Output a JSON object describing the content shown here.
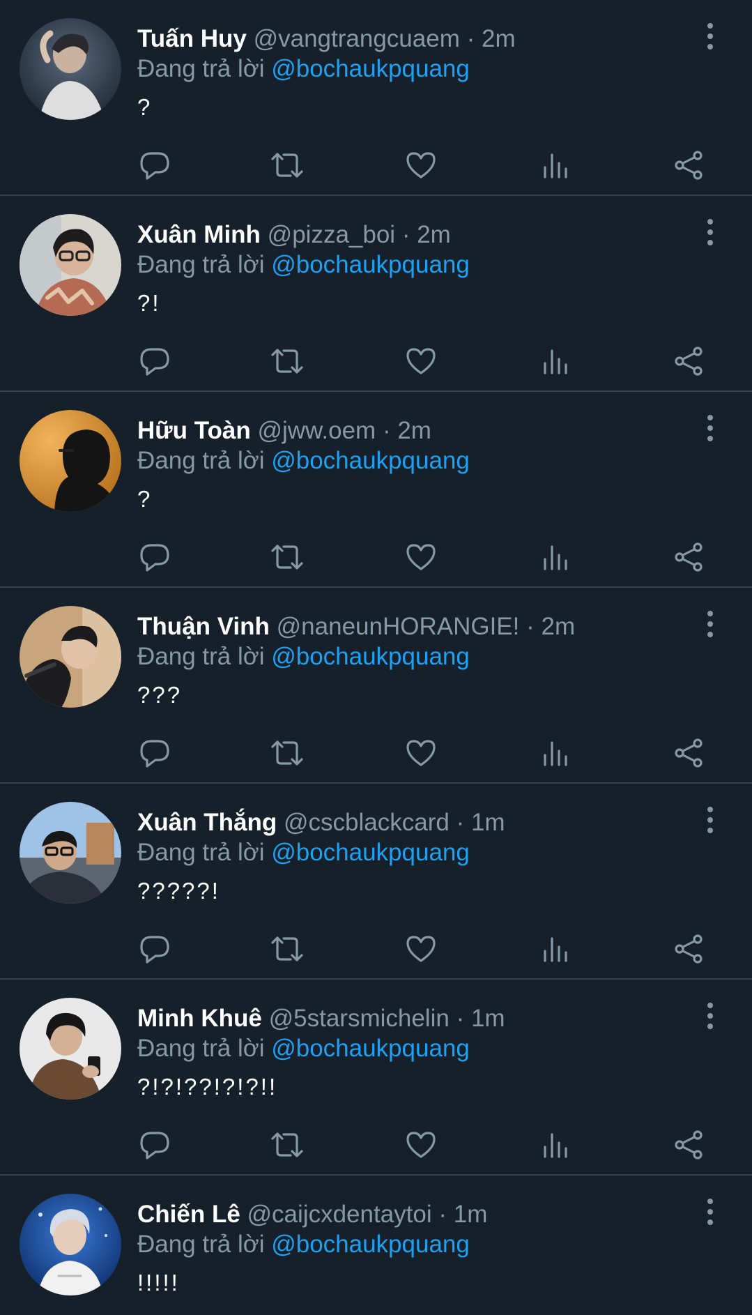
{
  "reply_prefix": "Đang trả lời",
  "separator": "·",
  "colors": {
    "background": "#15202b",
    "divider": "#38444d",
    "secondary_text": "#8899a6",
    "link": "#1da1f2",
    "primary_text": "#ffffff"
  },
  "action_icons": [
    "reply-icon",
    "retweet-icon",
    "like-icon",
    "analytics-icon",
    "share-icon"
  ],
  "tweets": [
    {
      "name": "Tuấn Huy",
      "handle": "@vangtrangcuaem",
      "time": "2m",
      "reply_to": "@bochaukpquang",
      "text": "?"
    },
    {
      "name": "Xuân Minh",
      "handle": "@pizza_boi",
      "time": "2m",
      "reply_to": "@bochaukpquang",
      "text": "?!"
    },
    {
      "name": "Hữu Toàn",
      "handle": "@jww.oem",
      "time": "2m",
      "reply_to": "@bochaukpquang",
      "text": "?"
    },
    {
      "name": "Thuận Vinh",
      "handle": "@naneunHORANGIE!",
      "time": "2m",
      "reply_to": "@bochaukpquang",
      "text": "???"
    },
    {
      "name": "Xuân Thắng",
      "handle": "@cscblackcard",
      "time": "1m",
      "reply_to": "@bochaukpquang",
      "text": "?????!"
    },
    {
      "name": "Minh Khuê",
      "handle": "@5starsmichelin",
      "time": "1m",
      "reply_to": "@bochaukpquang",
      "text": "?!?!??!?!?!!"
    },
    {
      "name": "Chiến Lê",
      "handle": "@caijcxdentaytoi",
      "time": "1m",
      "reply_to": "@bochaukpquang",
      "text": "!!!!!"
    }
  ]
}
